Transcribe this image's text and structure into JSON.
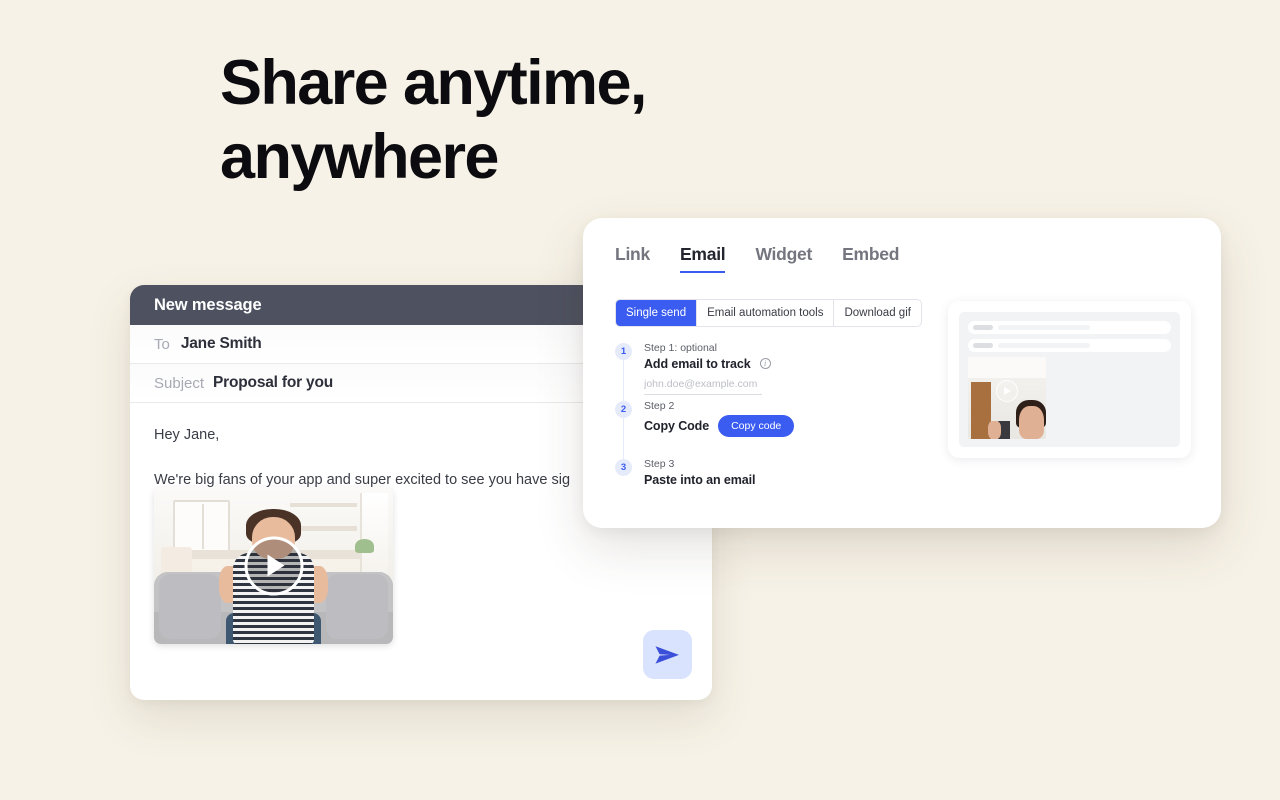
{
  "hero": {
    "line1": "Share anytime,",
    "line2": "anywhere"
  },
  "email_card": {
    "header_title": "New message",
    "to_label": "To",
    "to_value": "Jane Smith",
    "subject_label": "Subject",
    "subject_value": "Proposal for you",
    "greeting": "Hey Jane,",
    "paragraph": "We're big fans of your app and super excited to see you have sig",
    "video_alt": "Woman sitting on a gray couch in a bright kitchen, video thumbnail",
    "play_icon": "play-icon",
    "send_icon": "send-icon"
  },
  "share_panel": {
    "tabs": [
      {
        "label": "Link",
        "active": false
      },
      {
        "label": "Email",
        "active": true
      },
      {
        "label": "Widget",
        "active": false
      },
      {
        "label": "Embed",
        "active": false
      }
    ],
    "segmented": [
      {
        "label": "Single send",
        "active": true
      },
      {
        "label": "Email automation tools",
        "active": false
      },
      {
        "label": "Download gif",
        "active": false
      }
    ],
    "steps": [
      {
        "number": "1",
        "kicker": "Step 1: optional",
        "title": "Add email to track",
        "info_icon": "info-icon",
        "input_placeholder": "john.doe@example.com",
        "input_value": ""
      },
      {
        "number": "2",
        "kicker": "Step 2",
        "title": "Copy Code",
        "button_label": "Copy code"
      },
      {
        "number": "3",
        "kicker": "Step 3",
        "title": "Paste into an email"
      }
    ],
    "preview": {
      "alt": "Email preview with placeholder lines and a video thumbnail",
      "play_icon": "play-icon"
    }
  },
  "colors": {
    "background": "#f7f2e7",
    "accent_blue": "#3b5cf0",
    "accent_blue_soft": "#d9e3fd",
    "step_bullet_bg": "#e6ebfc",
    "email_header": "#4e5160",
    "heading": "#0c0c10",
    "muted_text": "#a7a9b4"
  }
}
